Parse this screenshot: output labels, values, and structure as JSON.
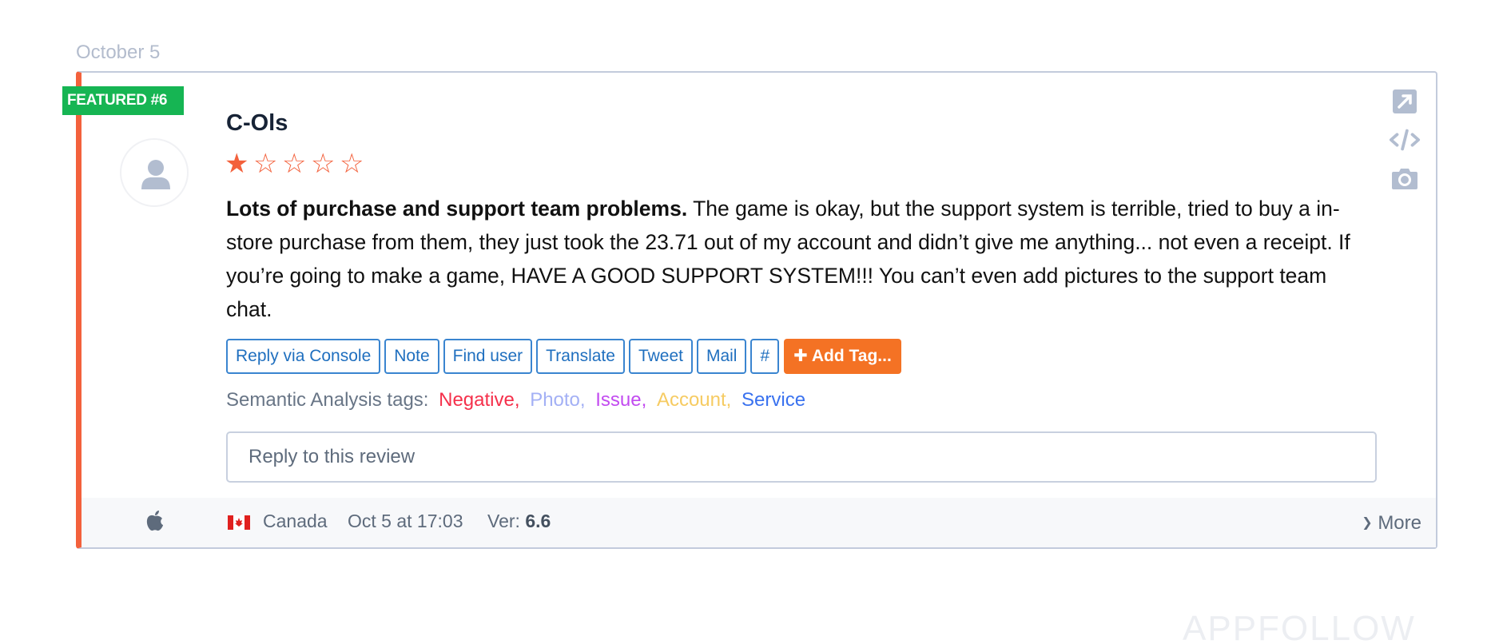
{
  "date_header": "October 5",
  "review": {
    "featured_badge": "FEATURED #6",
    "author": "C-Ols",
    "rating": 1,
    "rating_max": 5,
    "title": "Lots of purchase and support team problems.",
    "text": " The game is okay, but the support system is terrible, tried to buy a in-store purchase from them, they just took the 23.71 out of my account and didn’t give me anything... not even a receipt. If you’re going to make a game, HAVE A GOOD SUPPORT SYSTEM!!! You can’t even add pictures to the support team chat.",
    "star_color": "#f3613c",
    "accent_color": "#f3613c"
  },
  "actions": [
    {
      "label": "Reply via Console"
    },
    {
      "label": "Note"
    },
    {
      "label": "Find user"
    },
    {
      "label": "Translate"
    },
    {
      "label": "Tweet"
    },
    {
      "label": "Mail"
    },
    {
      "label": "#"
    }
  ],
  "add_tag": {
    "label": "Add Tag...",
    "icon": "plus-icon",
    "color": "#f47224"
  },
  "semantic": {
    "label": "Semantic Analysis tags:",
    "tags": [
      {
        "label": "Negative,",
        "color": "#f5304b"
      },
      {
        "label": "Photo,",
        "color": "#a3b0f5"
      },
      {
        "label": "Issue,",
        "color": "#c24bf0"
      },
      {
        "label": "Account,",
        "color": "#f6cb62"
      },
      {
        "label": "Service",
        "color": "#3a72ef"
      }
    ]
  },
  "reply_input": {
    "placeholder": "Reply to this review"
  },
  "footer": {
    "platform_icon": "apple-icon",
    "flag_icon": "canada-flag-icon",
    "country": "Canada",
    "datetime": "Oct 5 at 17:03",
    "version_label": "Ver:",
    "version": "6.6",
    "more_label": "More"
  },
  "side_icons": [
    "external-link-icon",
    "code-embed-icon",
    "screenshot-camera-icon"
  ],
  "watermark": "APPFOLLOW"
}
